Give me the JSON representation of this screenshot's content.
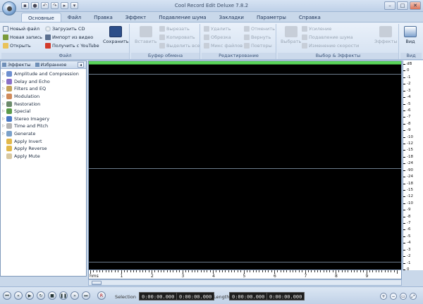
{
  "app": {
    "title": "Cool Record Edit Deluxe 7.8.2",
    "menu_tabs": [
      "Основные",
      "Файл",
      "Правка",
      "Эффект",
      "Подавление шума",
      "Закладки",
      "Параметры",
      "Справка"
    ]
  },
  "ribbon": {
    "file_group": {
      "label": "Файл",
      "new_file": "Новый файл",
      "new_record": "Новая запись",
      "open": "Открыть",
      "load_cd": "Загрузить CD",
      "import_video": "Импорт из видео",
      "get_youtube": "Получить с YouTube",
      "save": "Сохранить"
    },
    "clipboard_group": {
      "label": "Буфер обмена",
      "paste": "Вставить",
      "cut": "Вырезать",
      "copy": "Копировать",
      "select_all": "Выделить все"
    },
    "edit_group": {
      "label": "Редактирование",
      "delete": "Удалить",
      "trim": "Обрезка",
      "mix_files": "Микс файлов",
      "undo": "Отменить",
      "redo": "Вернуть",
      "repeat": "Повторы"
    },
    "effects_group": {
      "label": "Выбор & Эффекты",
      "select": "Выбрать",
      "amplify": "Усиление",
      "noise_reduction": "Подавление шума",
      "change_speed": "Изменение скорости",
      "effects": "Эффекты"
    },
    "view_group": {
      "label": "Вид",
      "view": "Вид"
    }
  },
  "panel": {
    "tab_effects": "Эффекты",
    "tab_favorites": "Избранное",
    "items": [
      "Amplitude and Compression",
      "Delay and Echo",
      "Filters and EQ",
      "Modulation",
      "Restoration",
      "Special",
      "Stereo Imagery",
      "Time and Pitch",
      "Generate",
      "Apply Invert",
      "Apply Reverse",
      "Apply Mute"
    ]
  },
  "db_scale": [
    "dB",
    "0",
    "-1",
    "-2",
    "-3",
    "-4",
    "-5",
    "-6",
    "-7",
    "-8",
    "-9",
    "-10",
    "-12",
    "-15",
    "-18",
    "-24",
    "-90",
    "-24",
    "-18",
    "-15",
    "-12",
    "-10",
    "-9",
    "-8",
    "-7",
    "-6",
    "-5",
    "-4",
    "-3",
    "-2",
    "-1",
    "0"
  ],
  "ruler": {
    "unit": "hms",
    "labels": [
      "1",
      "2",
      "3",
      "4",
      "5",
      "6",
      "7",
      "8",
      "9"
    ]
  },
  "status": {
    "selection_label": "Selection",
    "sel_start": "0:00:00.000",
    "sel_end": "0:00:00.000",
    "length_label": "Length",
    "len_start": "0:00:00.000",
    "len_end": "0:00:00.000"
  }
}
